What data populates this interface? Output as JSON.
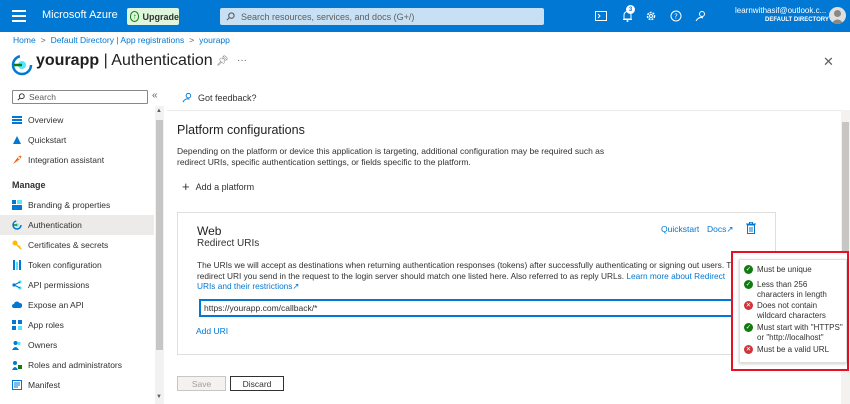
{
  "topbar": {
    "brand": "Microsoft Azure",
    "upgrade": "Upgrade",
    "search_placeholder": "Search resources, services, and docs (G+/)",
    "notification_count": "3",
    "account_email": "learnwithasif@outlook.c...",
    "account_directory": "DEFAULT DIRECTORY",
    "accent": "#0078d4"
  },
  "breadcrumb": [
    "Home",
    "Default Directory | App registrations",
    "yourapp"
  ],
  "title": {
    "app": "yourapp",
    "page": " | Authentication"
  },
  "sidebar": {
    "search_placeholder": "Search",
    "items_top": [
      {
        "label": "Overview",
        "icon": "overview-icon"
      },
      {
        "label": "Quickstart",
        "icon": "quickstart-icon"
      },
      {
        "label": "Integration assistant",
        "icon": "rocket-icon"
      }
    ],
    "manage_heading": "Manage",
    "items_manage": [
      {
        "label": "Branding & properties",
        "icon": "branding-icon"
      },
      {
        "label": "Authentication",
        "icon": "authentication-icon",
        "active": true
      },
      {
        "label": "Certificates & secrets",
        "icon": "key-icon"
      },
      {
        "label": "Token configuration",
        "icon": "token-icon"
      },
      {
        "label": "API permissions",
        "icon": "api-permissions-icon"
      },
      {
        "label": "Expose an API",
        "icon": "cloud-icon"
      },
      {
        "label": "App roles",
        "icon": "app-roles-icon"
      },
      {
        "label": "Owners",
        "icon": "owners-icon"
      },
      {
        "label": "Roles and administrators",
        "icon": "roles-icon"
      },
      {
        "label": "Manifest",
        "icon": "manifest-icon"
      }
    ]
  },
  "main": {
    "feedback": "Got feedback?",
    "section_title": "Platform configurations",
    "section_desc": "Depending on the platform or device this application is targeting, additional configuration may be required such as redirect URIs, specific authentication settings, or fields specific to the platform.",
    "add_platform": "Add a platform",
    "web": {
      "title": "Web",
      "subtitle": "Redirect URIs",
      "quickstart": "Quickstart",
      "docs": "Docs",
      "desc": "The URIs we will accept as destinations when returning authentication responses (tokens) after successfully authenticating or signing out users. The redirect URI you send in the request to the login server should match one listed here. Also referred to as reply URLs. ",
      "desc_link": "Learn more about Redirect URIs and their restrictions",
      "uri_value": "https://yourapp.com/callback/*",
      "add_uri": "Add URI"
    },
    "save": "Save",
    "discard": "Discard"
  },
  "validation": [
    {
      "text": "Must be unique",
      "status": "pass"
    },
    {
      "text": "Less than 256 characters in length",
      "status": "pass"
    },
    {
      "text": "Does not contain wildcard characters",
      "status": "fail"
    },
    {
      "text": "Must start with \"HTTPS\" or \"http://localhost\"",
      "status": "pass"
    },
    {
      "text": "Must be a valid URL",
      "status": "fail"
    }
  ],
  "colors": {
    "pass": "#107c10",
    "fail": "#d13438",
    "highlight_border": "#e81123"
  }
}
